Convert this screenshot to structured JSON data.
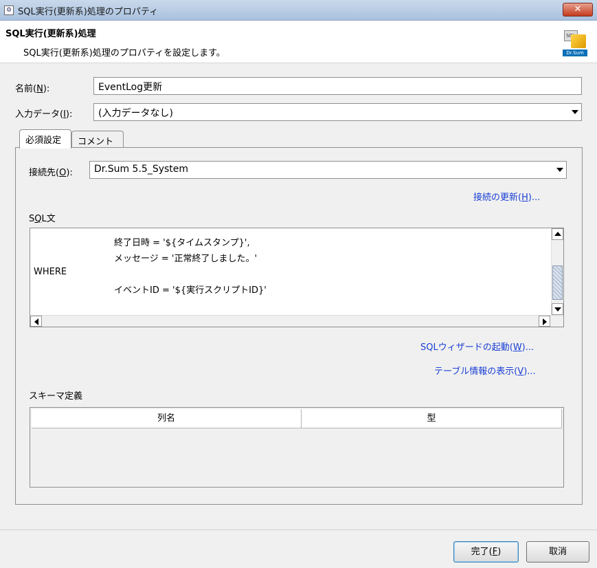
{
  "window": {
    "title": "SQL実行(更新系)処理のプロパティ",
    "close_label": "✕"
  },
  "header": {
    "title": "SQL実行(更新系)処理",
    "description": "SQL実行(更新系)処理のプロパティを設定します。",
    "logo_sql": "SQL",
    "logo_brand": "Dr.Sum"
  },
  "form": {
    "name_label": "名前(",
    "name_key": "N",
    "name_suffix": "):",
    "name_value": "EventLog更新",
    "input_label": "入力データ(",
    "input_key": "I",
    "input_suffix": "):",
    "input_value": "(入力データなし)"
  },
  "tabs": [
    {
      "label": "必須設定",
      "active": true
    },
    {
      "label": "コメント",
      "active": false
    }
  ],
  "panel": {
    "connection_label": "接続先(",
    "connection_key": "O",
    "connection_suffix": "):",
    "connection_value": "Dr.Sum 5.5_System",
    "refresh_link": "接続の更新(",
    "refresh_key": "H",
    "refresh_suffix": ")...",
    "sql_label_pre": "S",
    "sql_label_key": "Q",
    "sql_label_post": "L文",
    "sql_lines": [
      "終了日時 = '${タイムスタンプ}',",
      "メッセージ = '正常終了しました。'",
      "WHERE",
      "イベントID = '${実行スクリプトID}'"
    ],
    "wizard_link": "SQLウィザードの起動(",
    "wizard_key": "W",
    "wizard_suffix": ")...",
    "table_info_link": "テーブル情報の表示(",
    "table_info_key": "V",
    "table_info_suffix": ")...",
    "schema_label": "スキーマ定義",
    "schema_columns": [
      "列名",
      "型"
    ]
  },
  "footer": {
    "finish_label": "完了(",
    "finish_key": "F",
    "finish_suffix": ")",
    "cancel_label": "取消"
  },
  "colors": {
    "link": "#1a3fd4",
    "close_button": "#c43c1d",
    "brand": "#0a6fb7"
  }
}
